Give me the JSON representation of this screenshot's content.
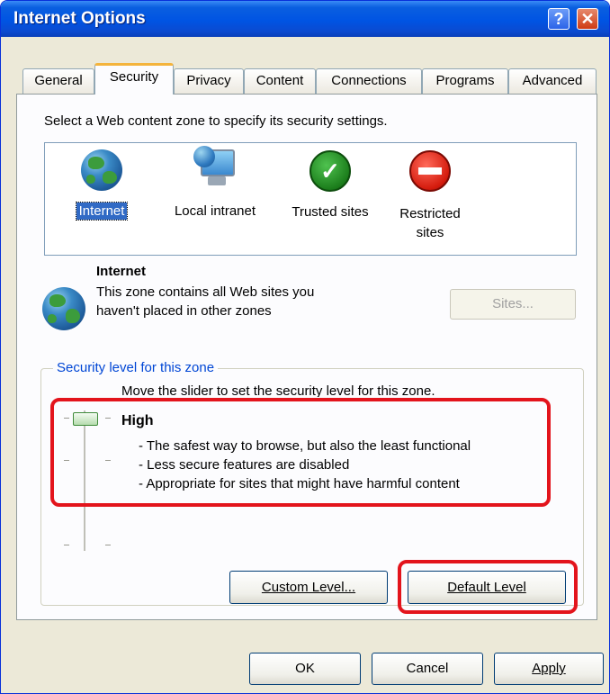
{
  "window": {
    "title": "Internet Options",
    "help_symbol": "?",
    "close_symbol": "✕"
  },
  "tabs": [
    {
      "label": "General"
    },
    {
      "label": "Security",
      "active": true
    },
    {
      "label": "Privacy"
    },
    {
      "label": "Content"
    },
    {
      "label": "Connections"
    },
    {
      "label": "Programs"
    },
    {
      "label": "Advanced"
    }
  ],
  "security": {
    "instruction": "Select a Web content zone to specify its security settings.",
    "zones": [
      {
        "label": "Internet",
        "icon": "globe-icon",
        "selected": true
      },
      {
        "label": "Local intranet",
        "icon": "intranet-monitor-icon"
      },
      {
        "label": "Trusted sites",
        "icon": "checkmark-icon"
      },
      {
        "label": "Restricted sites",
        "icon": "no-entry-icon"
      }
    ],
    "zone_info": {
      "name": "Internet",
      "description_line1": "This zone contains all Web sites you",
      "description_line2": "haven't placed in other zones",
      "sites_button": "Sites..."
    },
    "level_group": {
      "label": "Security level for this zone",
      "slider_hint": "Move the slider to set the security level for this zone.",
      "level_name": "High",
      "bullets": [
        "- The safest way to browse, but also the least functional",
        "- Less secure features are disabled",
        "- Appropriate for sites that might have harmful content"
      ],
      "custom_button": "Custom Level...",
      "default_button": "Default Level"
    }
  },
  "footer": {
    "ok": "OK",
    "cancel": "Cancel",
    "apply": "Apply"
  },
  "colors": {
    "titlebar": "#0054e3",
    "highlight_box": "#e3141c",
    "group_label": "#0046d5",
    "selection": "#316ac5"
  }
}
